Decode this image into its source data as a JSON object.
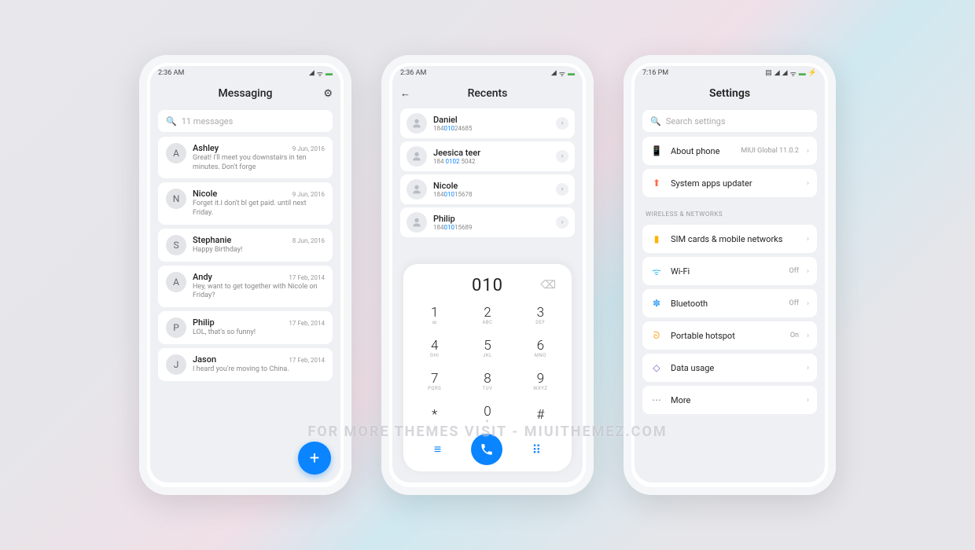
{
  "watermark": "FOR MORE THEMES VISIT - MIUITHEMEZ.COM",
  "phone1": {
    "time": "2:36 AM",
    "title": "Messaging",
    "search_placeholder": "11 messages",
    "fab": "+",
    "messages": [
      {
        "initial": "A",
        "name": "Ashley",
        "date": "9 Jun, 2016",
        "text": "Great! I'll meet you downstairs in ten minutes. Don't forge"
      },
      {
        "initial": "N",
        "name": "Nicole",
        "date": "9 Jun, 2016",
        "text": "Forget it.I don't bl get paid. until next Friday."
      },
      {
        "initial": "S",
        "name": "Stephanie",
        "date": "8 Jun, 2016",
        "text": "Happy Birthday!"
      },
      {
        "initial": "A",
        "name": "Andy",
        "date": "17 Feb, 2014",
        "text": "Hey, want to get together with Nicole on Friday?"
      },
      {
        "initial": "P",
        "name": "Philip",
        "date": "17 Feb, 2014",
        "text": "LOL, that's so funny!"
      },
      {
        "initial": "J",
        "name": "Jason",
        "date": "17 Feb, 2014",
        "text": "I heard you're moving to China."
      }
    ]
  },
  "phone2": {
    "time": "2:36 AM",
    "title": "Recents",
    "dialed": "010",
    "recents": [
      {
        "name": "Daniel",
        "pre": "184",
        "hl": "010",
        "post": "24685"
      },
      {
        "name": "Jeesica teer",
        "pre": "184 ",
        "hl": "0102",
        "post": " 5042"
      },
      {
        "name": "Nicole",
        "pre": "184",
        "hl": "010",
        "post": "15678"
      },
      {
        "name": "Philip",
        "pre": "184",
        "hl": "010",
        "post": "15689"
      }
    ],
    "keys": [
      {
        "n": "1",
        "l": "∞"
      },
      {
        "n": "2",
        "l": "ABC"
      },
      {
        "n": "3",
        "l": "DEF"
      },
      {
        "n": "4",
        "l": "GHI"
      },
      {
        "n": "5",
        "l": "JKL"
      },
      {
        "n": "6",
        "l": "MNO"
      },
      {
        "n": "7",
        "l": "PQRS"
      },
      {
        "n": "8",
        "l": "TUV"
      },
      {
        "n": "9",
        "l": "WXYZ"
      },
      {
        "n": "*",
        "l": ""
      },
      {
        "n": "0",
        "l": "+"
      },
      {
        "n": "#",
        "l": ""
      }
    ]
  },
  "phone3": {
    "time": "7:16 PM",
    "title": "Settings",
    "search_placeholder": "Search settings",
    "section_label": "WIRELESS & NETWORKS",
    "group_top": [
      {
        "icon": "📱",
        "color": "#4fc3f7",
        "label": "About phone",
        "value": "MIUI Global 11.0.2"
      },
      {
        "icon": "⬆",
        "color": "#ff6b4a",
        "label": "System apps updater",
        "value": ""
      }
    ],
    "group_net": [
      {
        "icon": "▮",
        "color": "#ffb300",
        "label": "SIM cards & mobile networks",
        "value": ""
      },
      {
        "icon": "ᯤ",
        "color": "#29b6f6",
        "label": "Wi-Fi",
        "value": "Off"
      },
      {
        "icon": "✽",
        "color": "#42a5f5",
        "label": "Bluetooth",
        "value": "Off"
      },
      {
        "icon": "ᘐ",
        "color": "#ffa726",
        "label": "Portable hotspot",
        "value": "On"
      },
      {
        "icon": "◇",
        "color": "#7e57c2",
        "label": "Data usage",
        "value": ""
      },
      {
        "icon": "⋯",
        "color": "#78909c",
        "label": "More",
        "value": ""
      }
    ]
  }
}
